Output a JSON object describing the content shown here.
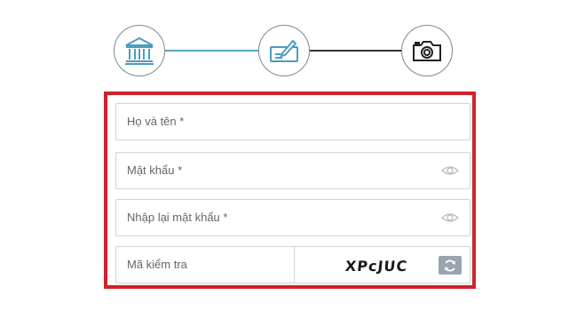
{
  "steps": {
    "items": [
      {
        "icon": "bank-icon"
      },
      {
        "icon": "check-card-icon"
      },
      {
        "icon": "camera-icon"
      }
    ],
    "colors": {
      "active_line": "#5aa6c4",
      "inactive_line": "#333333",
      "circle_border": "#7a8a90"
    }
  },
  "form": {
    "border_color": "#d0222c",
    "full_name_placeholder": "Họ và tên *",
    "password_placeholder": "Mật khẩu *",
    "confirm_password_placeholder": "Nhập lại mật khẩu *",
    "captcha_placeholder": "Mã kiểm tra",
    "captcha_code": "XPcJUC"
  }
}
